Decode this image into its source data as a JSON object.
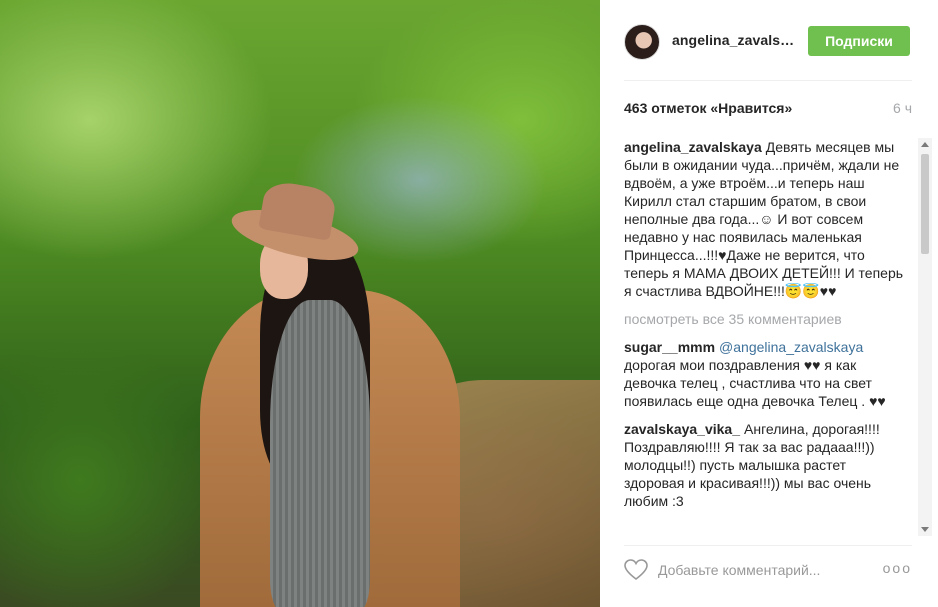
{
  "post": {
    "username": "angelina_zavals…",
    "follow_label": "Подписки",
    "likes": "463 отметок «Нравится»",
    "time": "6 ч",
    "caption_user": "angelina_zavalskaya",
    "caption_text": "Девять месяцев мы были в ожидании чуда...причём, ждали не вдвоём, а уже втроём...и теперь наш Кирилл стал старшим братом, в свои неполные два года...☺ И вот совсем недавно у нас появилась маленькая Принцесса...!!!♥Даже не верится, что теперь я МАМА ДВОИХ ДЕТЕЙ!!! И теперь я счастлива ВДВОЙНЕ!!!😇😇♥♥",
    "view_all": "посмотреть все 35 комментариев",
    "comments": [
      {
        "user": "sugar__mmm",
        "mention": "@angelina_zavalskaya",
        "text": "дорогая мои поздравления ♥♥ я как девочка телец , счастлива что на свет появилась еще одна девочка Телец . ♥♥"
      },
      {
        "user": "zavalskaya_vika_",
        "mention": "",
        "text": "Ангелина, дорогая!!!! Поздравляю!!!! Я так за вас радааа!!!)) молодцы!!) пусть малышка растет здоровая и красивая!!!)) мы вас очень любим :3"
      }
    ],
    "add_comment_placeholder": "Добавьте комментарий...",
    "more_options": "ooo"
  },
  "icons": {
    "avatar": "avatar",
    "like": "heart-icon",
    "options": "more-options-icon"
  },
  "colors": {
    "follow_button": "#70c050",
    "mention": "#3f729b",
    "muted_text": "#a5a7aa"
  }
}
